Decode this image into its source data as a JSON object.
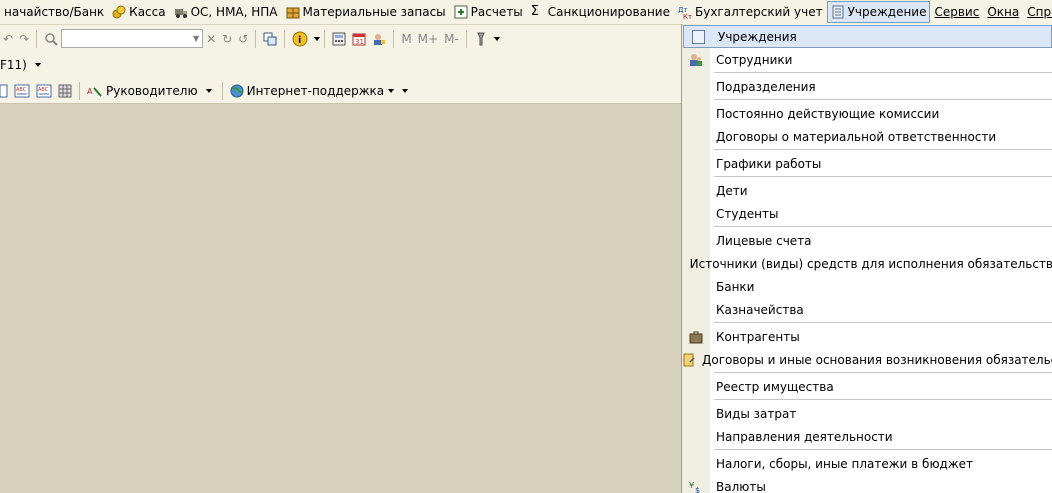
{
  "menubar": {
    "items": [
      {
        "label": "начайство/Банк",
        "icon": "none"
      },
      {
        "label": "Касса",
        "icon": "coins-icon"
      },
      {
        "label": "ОС, НМА, НПА",
        "icon": "truck-icon"
      },
      {
        "label": "Материальные запасы",
        "icon": "boxes-icon"
      },
      {
        "label": "Расчеты",
        "icon": "calc-icon"
      },
      {
        "label": "Санкционирование",
        "icon": "sigma-icon"
      },
      {
        "label": "Бухгалтерский учет",
        "icon": "ledger-icon"
      },
      {
        "label": "Учреждение",
        "icon": "building-icon"
      },
      {
        "label": "Сервис",
        "icon": "none"
      },
      {
        "label": "Окна",
        "icon": "none"
      },
      {
        "label": "Справка",
        "icon": "none"
      }
    ]
  },
  "toolbar2": {
    "label": "F11)"
  },
  "toolbar3": {
    "manager_label": "Руководителю",
    "support_label": "Интернет-поддержка"
  },
  "toolbar1": {
    "m_label": "M",
    "m_plus_label": "M+",
    "m_minus_label": "M-"
  },
  "dropdown": {
    "items": [
      {
        "label": "Учреждения",
        "icon": "document-icon",
        "highlighted": true
      },
      {
        "label": "Сотрудники",
        "icon": "people-icon"
      },
      {
        "sep": true
      },
      {
        "label": "Подразделения"
      },
      {
        "sep": true
      },
      {
        "label": "Постоянно действующие комиссии"
      },
      {
        "label": "Договоры о материальной ответственности"
      },
      {
        "sep": true
      },
      {
        "label": "Графики работы"
      },
      {
        "sep": true
      },
      {
        "label": "Дети"
      },
      {
        "label": "Студенты"
      },
      {
        "sep": true
      },
      {
        "label": "Лицевые счета"
      },
      {
        "label": "Источники (виды) средств для исполнения обязательств"
      },
      {
        "label": "Банки"
      },
      {
        "label": "Казначейства"
      },
      {
        "sep": true
      },
      {
        "label": "Контрагенты",
        "icon": "briefcase-icon"
      },
      {
        "label": "Договоры и иные основания возникновения обязательств",
        "icon": "contract-icon"
      },
      {
        "sep": true
      },
      {
        "label": "Реестр имущества"
      },
      {
        "sep": true
      },
      {
        "label": "Виды затрат"
      },
      {
        "label": "Направления деятельности"
      },
      {
        "sep": true
      },
      {
        "label": "Налоги, сборы, иные платежи в бюджет"
      },
      {
        "label": "Валюты",
        "icon": "currency-icon"
      }
    ]
  }
}
